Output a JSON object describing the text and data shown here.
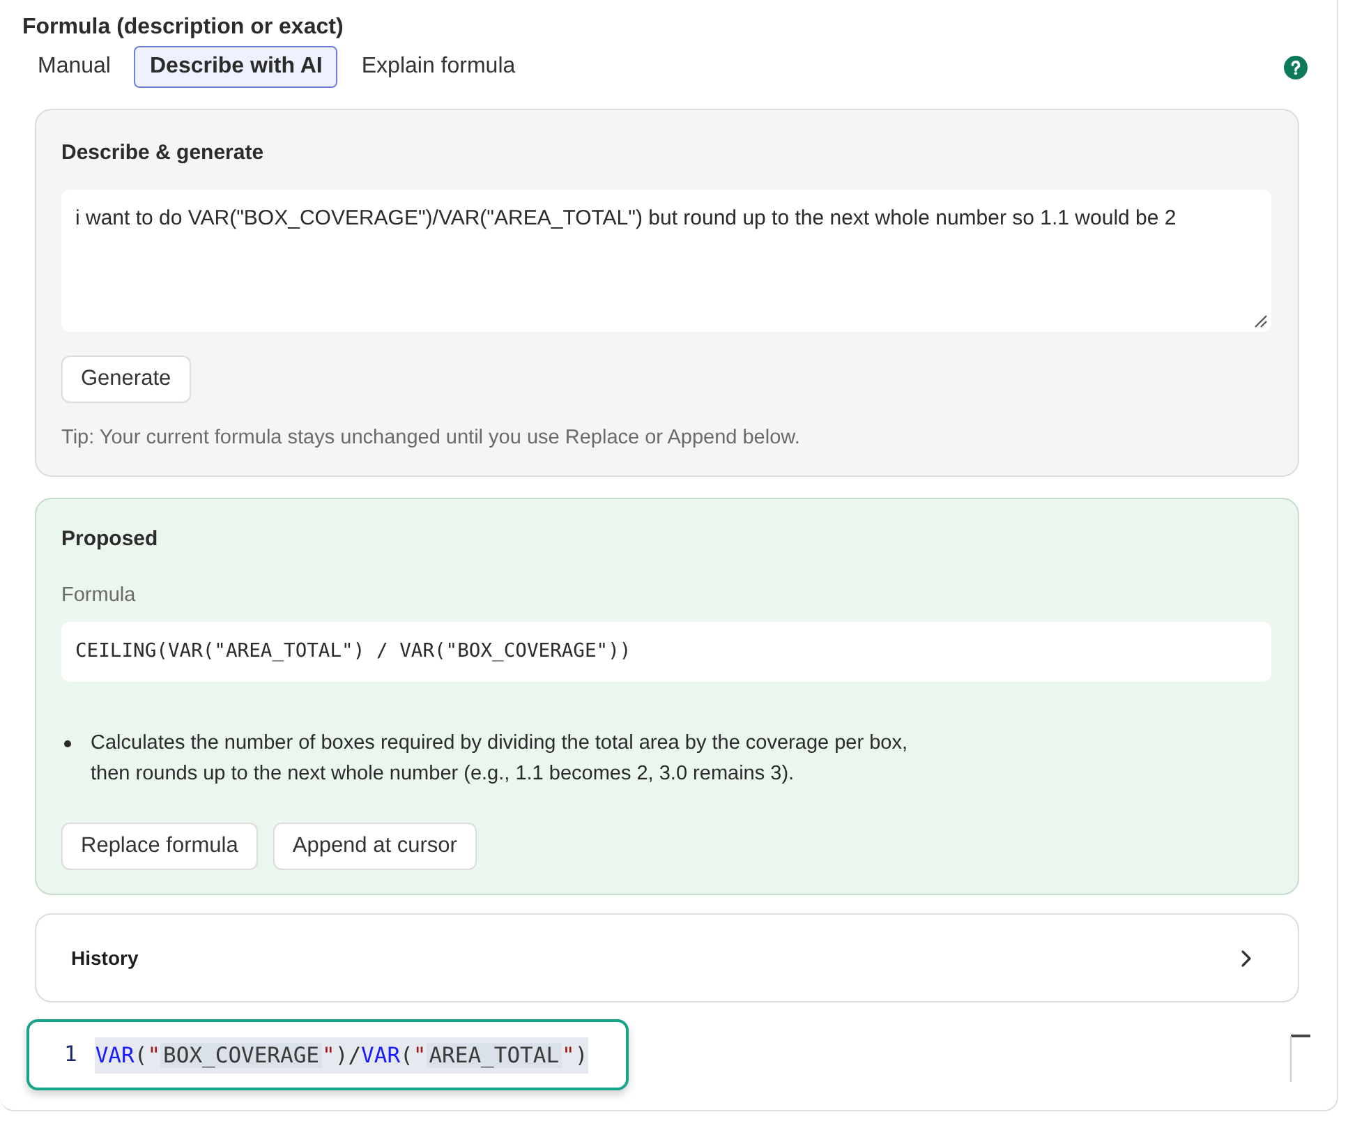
{
  "title": "Formula (description or exact)",
  "tabs": [
    {
      "label": "Manual",
      "selected": false
    },
    {
      "label": "Describe with AI",
      "selected": true
    },
    {
      "label": "Explain formula",
      "selected": false
    }
  ],
  "describe": {
    "heading": "Describe & generate",
    "description": "i want to do VAR(\"BOX_COVERAGE\")/VAR(\"AREA_TOTAL\") but round up to the next whole number so 1.1 would be 2",
    "button": "Generate",
    "tip": "Tip: Your current formula stays unchanged until you use Replace or Append below."
  },
  "proposed": {
    "heading": "Proposed",
    "formula_label": "Formula",
    "formula": "CEILING(VAR(\"AREA_TOTAL\") / VAR(\"BOX_COVERAGE\"))",
    "notes": [
      "Calculates the number of boxes required by dividing the total area by the coverage per box,\nthen rounds up to the next whole number (e.g., 1.1 becomes 2, 3.0 remains 3)."
    ],
    "buttons": [
      "Replace formula",
      "Append at cursor"
    ]
  },
  "history": {
    "label": "History",
    "expanded": false
  },
  "editor": {
    "lines": [
      {
        "number": "1",
        "selected": true,
        "tokens": [
          {
            "kind": "function",
            "text": "VAR"
          },
          {
            "kind": "punctuation",
            "text": "("
          },
          {
            "kind": "quote",
            "text": "\""
          },
          {
            "kind": "string",
            "text": "BOX_COVERAGE"
          },
          {
            "kind": "quote",
            "text": "\""
          },
          {
            "kind": "punctuation",
            "text": ")/"
          },
          {
            "kind": "function",
            "text": "VAR"
          },
          {
            "kind": "punctuation",
            "text": "("
          },
          {
            "kind": "quote",
            "text": "\""
          },
          {
            "kind": "string",
            "text": "AREA_TOTAL"
          },
          {
            "kind": "quote",
            "text": "\""
          },
          {
            "kind": "punctuation",
            "text": ")"
          }
        ]
      }
    ]
  }
}
